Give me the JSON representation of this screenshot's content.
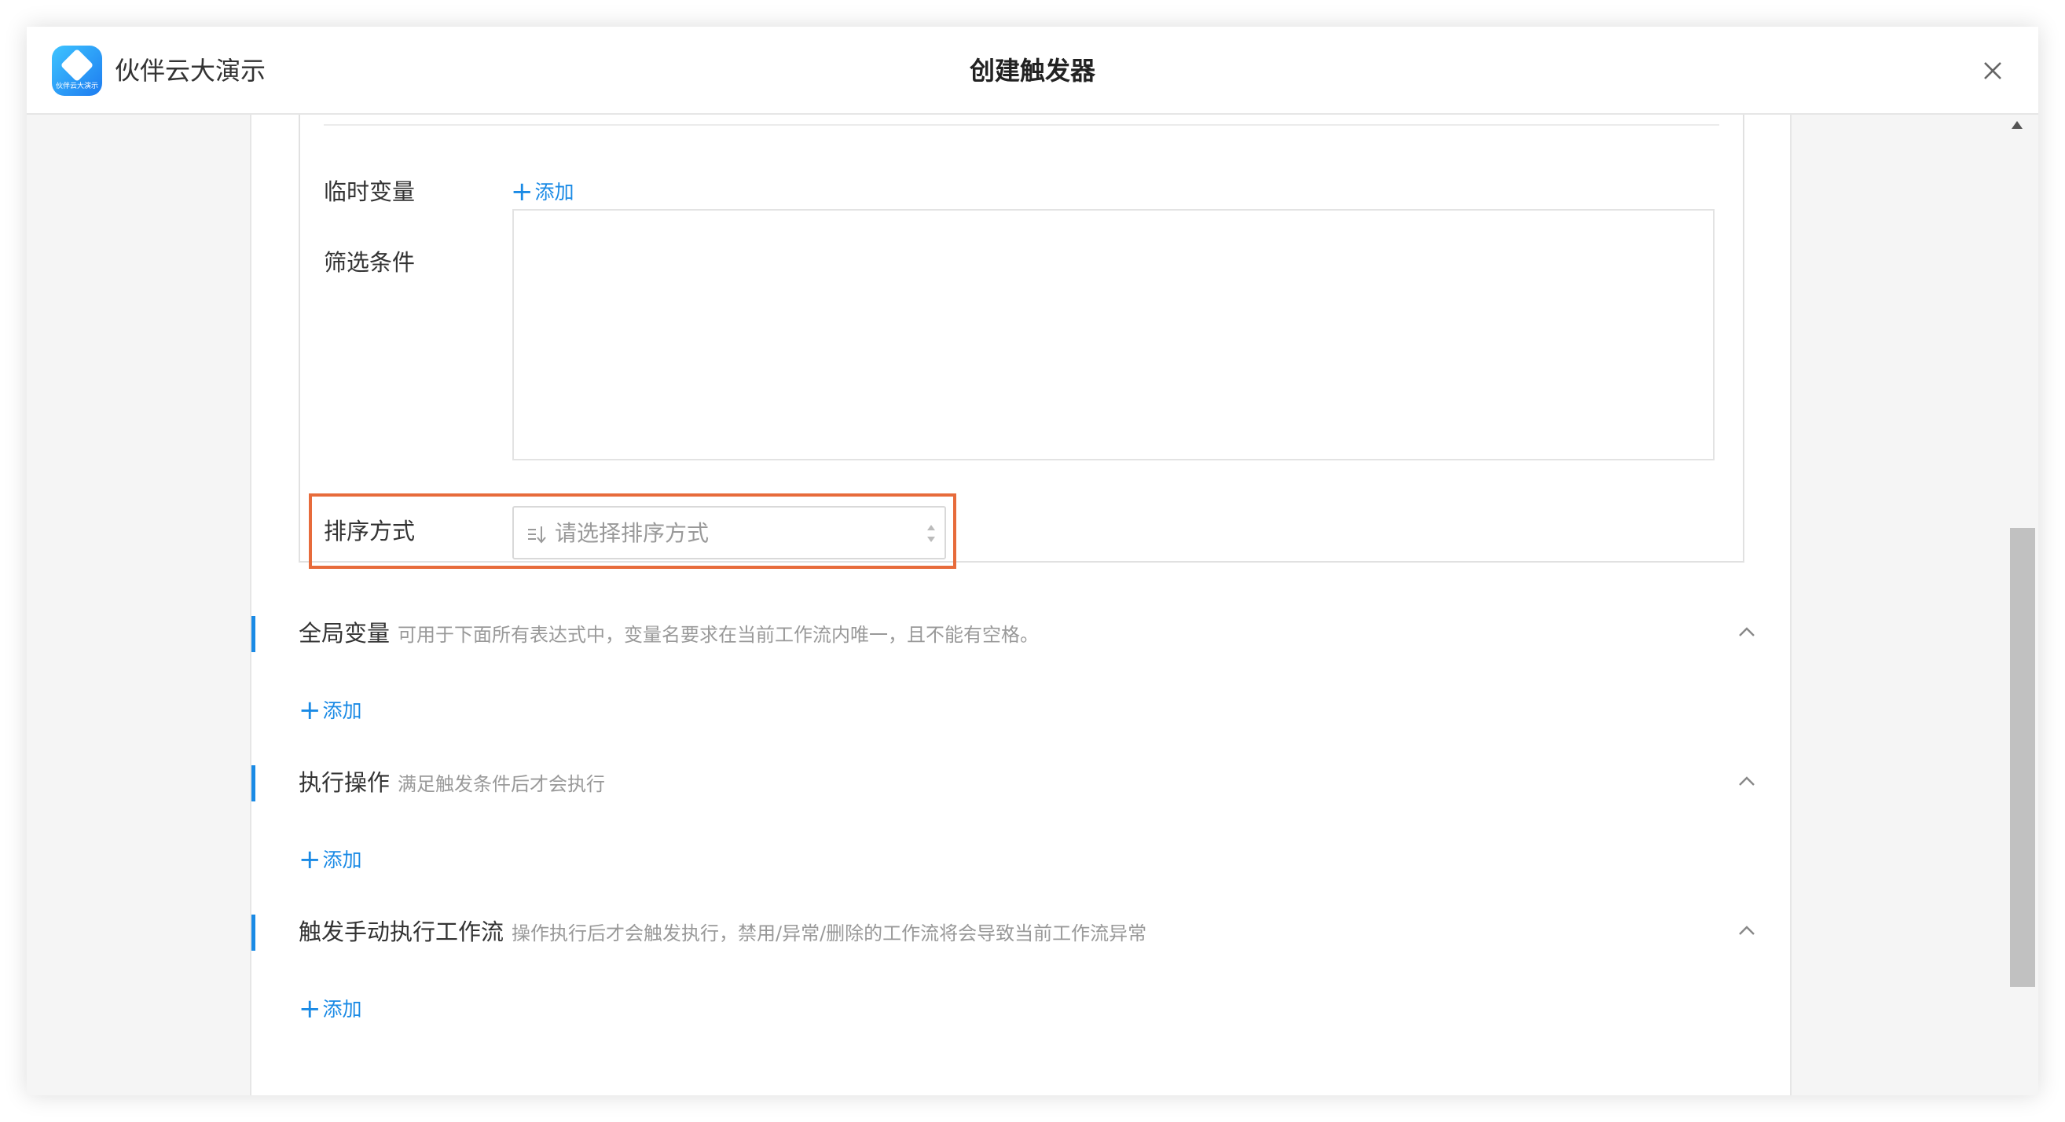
{
  "app": {
    "logo_text": "伙伴云大演示",
    "name": "伙伴云大演示"
  },
  "dialog": {
    "title": "创建触发器"
  },
  "filter": {
    "temp_var_label": "临时变量",
    "temp_var_add": "添加",
    "condition_label": "筛选条件",
    "sort_label": "排序方式",
    "sort_placeholder": "请选择排序方式"
  },
  "sections": [
    {
      "title": "全局变量",
      "desc": "可用于下面所有表达式中，变量名要求在当前工作流内唯一，且不能有空格。",
      "add": "添加"
    },
    {
      "title": "执行操作",
      "desc": "满足触发条件后才会执行",
      "add": "添加"
    },
    {
      "title": "触发手动执行工作流",
      "desc": "操作执行后才会触发执行，禁用/异常/删除的工作流将会导致当前工作流异常",
      "add": "添加"
    }
  ],
  "colors": {
    "accent": "#1a8ae5",
    "highlight": "#e76b3b",
    "muted": "#999999"
  },
  "icons": [
    "app-logo",
    "close-icon",
    "plus-icon",
    "sort-icon",
    "select-arrows-icon",
    "chevron-up-icon",
    "scroll-up-arrow"
  ]
}
